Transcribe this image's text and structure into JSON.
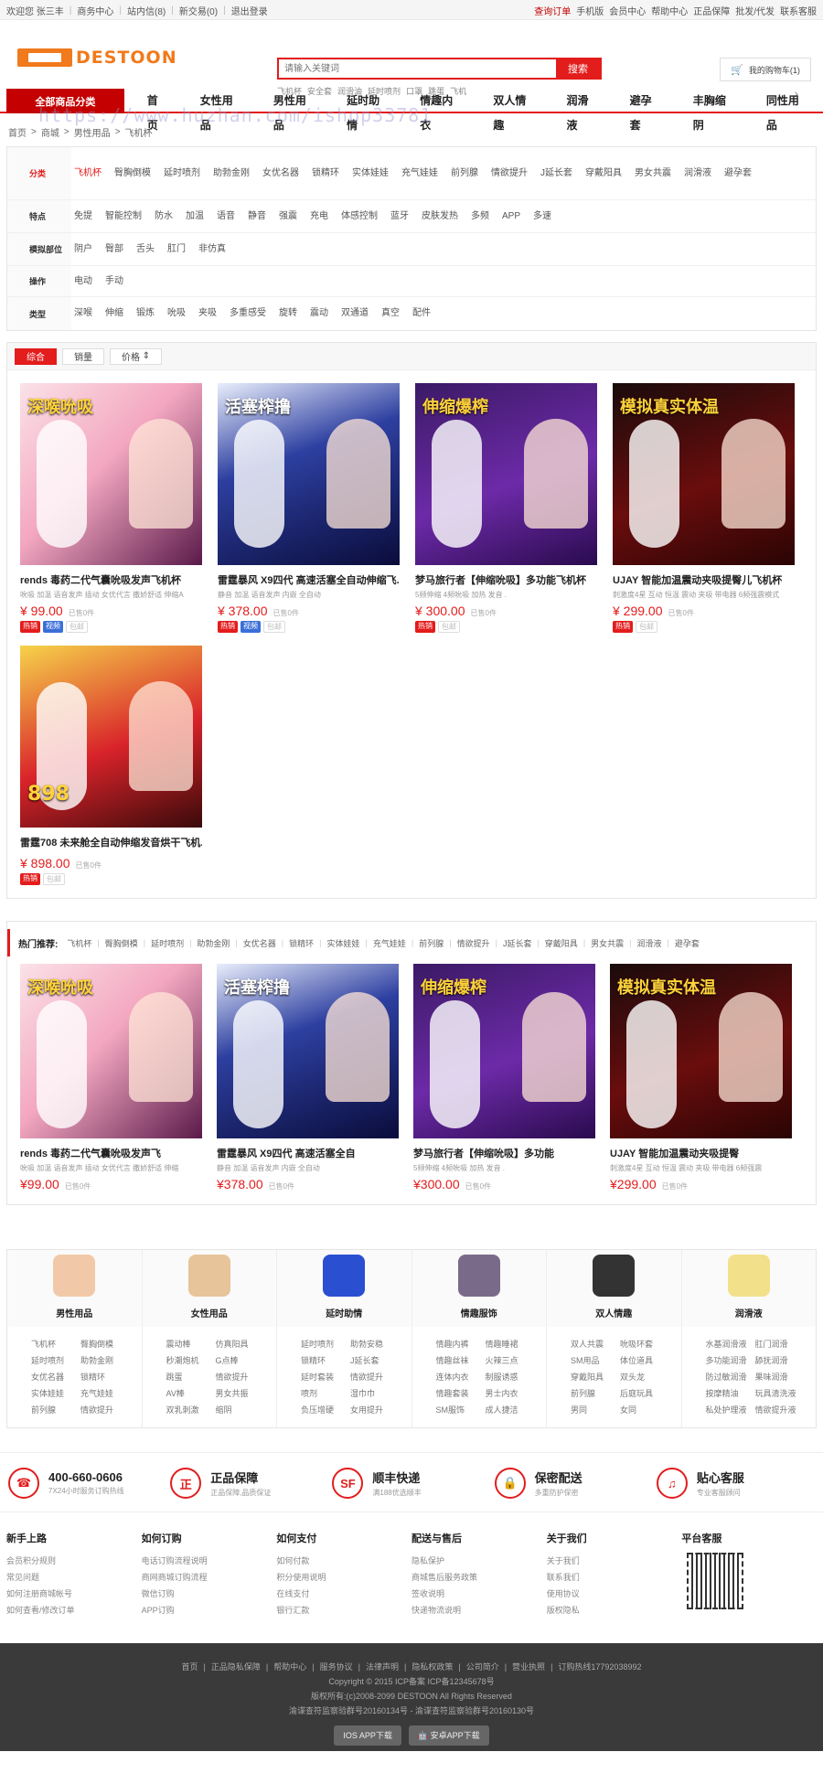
{
  "topbar": {
    "left": [
      "欢迎您 张三丰",
      "商务中心",
      "站内信(8)",
      "新交易(0)",
      "退出登录"
    ],
    "right": [
      "查询订单",
      "手机版",
      "会员中心",
      "帮助中心",
      "正品保障",
      "批发/代发",
      "联系客服"
    ]
  },
  "header": {
    "logo_text": "DESTOON",
    "search_placeholder": "请输入关键词",
    "search_button": "搜索",
    "hot_words": [
      "飞机杯",
      "安全套",
      "润滑油",
      "延时喷剂",
      "口罩",
      "跳蛋",
      "飞机"
    ],
    "cart_label": "我的购物车(1)"
  },
  "nav": {
    "all_categories": "全部商品分类",
    "items": [
      "首页",
      "女性用品",
      "男性用品",
      "延时助情",
      "情趣内衣",
      "双人情趣",
      "润滑液",
      "避孕套",
      "丰胸缩阴",
      "同性用品"
    ]
  },
  "watermark": "https://www.huzhan.com/ishop33781",
  "breadcrumb": [
    "首页",
    ">",
    "商城",
    ">",
    "男性用品",
    ">",
    "飞机杯"
  ],
  "filters": [
    {
      "label": "分类",
      "options": [
        "飞机杯",
        "臀胸倒模",
        "延时喷剂",
        "助勃金刚",
        "女优名器",
        "锁精环",
        "实体娃娃",
        "充气娃娃",
        "前列腺",
        "情欲提升",
        "J延长套",
        "穿戴阳具",
        "男女共震",
        "润滑液",
        "避孕套"
      ]
    },
    {
      "label": "特点",
      "options": [
        "免提",
        "智能控制",
        "防水",
        "加温",
        "语音",
        "静音",
        "强震",
        "充电",
        "体感控制",
        "蓝牙",
        "皮肤发热",
        "多频",
        "APP",
        "多速"
      ]
    },
    {
      "label": "模拟部位",
      "options": [
        "阴户",
        "臀部",
        "舌头",
        "肛门",
        "非仿真"
      ]
    },
    {
      "label": "操作",
      "options": [
        "电动",
        "手动"
      ]
    },
    {
      "label": "类型",
      "options": [
        "深喉",
        "伸缩",
        "锻炼",
        "吮吸",
        "夹吸",
        "多重感受",
        "旋转",
        "震动",
        "双通道",
        "真空",
        "配件"
      ]
    }
  ],
  "sort": {
    "comprehensive": "综合",
    "sales": "销量",
    "price": "价格"
  },
  "products": [
    {
      "name": "rends 毒药二代气囊吮吸发声飞机杯",
      "tags": "吮吸 加温 语音发声 插动 女优代言 撒娇舒适 伸缩A",
      "price": "¥ 99.00",
      "sold": "已售0件",
      "badges": [
        "热销",
        "视频",
        "包邮"
      ],
      "img": "im1",
      "title_overlay": "深喉吮吸"
    },
    {
      "name": "雷霆暴风 X9四代 高速活塞全自动伸缩飞...",
      "tags": "静音 加温 语音发声 内嵌 全自动",
      "price": "¥ 378.00",
      "sold": "已售0件",
      "badges": [
        "热销",
        "视频",
        "包邮"
      ],
      "img": "im2",
      "title_overlay": "活塞榨撸"
    },
    {
      "name": "梦马旅行者【伸缩吮吸】多功能飞机杯",
      "tags": "5频伸缩 4频吮吸 加热 发音 .",
      "price": "¥ 300.00",
      "sold": "已售0件",
      "badges": [
        "热销",
        "包邮"
      ],
      "img": "im3",
      "title_overlay": "伸缩爆榨"
    },
    {
      "name": "UJAY 智能加温震动夹吸提臀儿飞机杯",
      "tags": "刺激度4星 互动 恒温 震动 夹吸 带电器 6频强震模式",
      "price": "¥ 299.00",
      "sold": "已售0件",
      "badges": [
        "热销",
        "包邮"
      ],
      "img": "im4",
      "title_overlay": "模拟真实体温"
    },
    {
      "name": "雷霆708 未来舱全自动伸缩发音烘干飞机...",
      "tags": "",
      "price": "¥ 898.00",
      "sold": "已售0件",
      "badges": [
        "热销",
        "包邮"
      ],
      "img": "im5",
      "title_overlay": "898"
    }
  ],
  "hot": {
    "label": "热门推荐:",
    "items": [
      "飞机杯",
      "臀胸倒模",
      "延时喷剂",
      "助勃金刚",
      "女优名器",
      "锁精环",
      "实体娃娃",
      "充气娃娃",
      "前列腺",
      "情欲提升",
      "J延长套",
      "穿戴阳具",
      "男女共震",
      "润滑液",
      "避孕套"
    ],
    "products": [
      {
        "name": "rends 毒药二代气囊吮吸发声飞",
        "tags": "吮吸 加温 语音发声 插动 女优代言 撒娇舒适 伸缩",
        "price": "¥99.00",
        "sold": "已售0件",
        "img": "im1",
        "title_overlay": "深喉吮吸"
      },
      {
        "name": "雷霆暴风 X9四代 高速活塞全自",
        "tags": "静音 加温 语音发声 内嵌 全自动",
        "price": "¥378.00",
        "sold": "已售0件",
        "img": "im2",
        "title_overlay": "活塞榨撸"
      },
      {
        "name": "梦马旅行者【伸缩吮吸】多功能",
        "tags": "5频伸缩 4频吮吸 加热 发音 .",
        "price": "¥300.00",
        "sold": "已售0件",
        "img": "im3",
        "title_overlay": "伸缩爆榨"
      },
      {
        "name": "UJAY 智能加温震动夹吸提臀",
        "tags": "刺激度4星 互动 恒温 震动 夹吸 带电器 6频强震",
        "price": "¥299.00",
        "sold": "已售0件",
        "img": "im4",
        "title_overlay": "模拟真实体温"
      }
    ]
  },
  "categories": [
    {
      "title": "男性用品",
      "color": "#f2c9a8",
      "links": [
        "飞机杯",
        "臀胸倒模",
        "延时喷剂",
        "助勃金刚",
        "女优名器",
        "锁精环",
        "实体娃娃",
        "充气娃娃",
        "前列腺",
        "情欲提升"
      ]
    },
    {
      "title": "女性用品",
      "color": "#e8c49a",
      "links": [
        "震动棒",
        "仿真阳具",
        "秒潮炮机",
        "G点棒",
        "跳蛋",
        "情欲提升",
        "AV棒",
        "男女共振",
        "双乳刺激",
        "缩阴"
      ]
    },
    {
      "title": "延时助情",
      "color": "#2a4fd0",
      "links": [
        "延时喷剂",
        "助勃安稳",
        "锁精环",
        "J延长套",
        "延时套装",
        "情欲提升",
        "喷剂",
        "湿巾巾",
        "负压增硬",
        "女用提升"
      ]
    },
    {
      "title": "情趣服饰",
      "color": "#7a6a8a",
      "links": [
        "情趣内裤",
        "情趣睡裙",
        "情趣丝袜",
        "火辣三点",
        "连体内衣",
        "制服诱惑",
        "情趣套装",
        "男士内衣",
        "SM服饰",
        "成人捷洁"
      ]
    },
    {
      "title": "双人情趣",
      "color": "#333333",
      "links": [
        "双人共震",
        "吮吸环套",
        "SM用品",
        "体位道具",
        "穿戴阳具",
        "双头龙",
        "前列腺",
        "后庭玩具",
        "男同",
        "女同"
      ]
    },
    {
      "title": "润滑液",
      "color": "#f3e08a",
      "links": [
        "水基润滑液",
        "肛门润滑",
        "多功能润滑",
        "舔抚润滑",
        "防过敏润滑",
        "果味润滑",
        "按摩精油",
        "玩具清洗液",
        "私处护理液",
        "情欲提升液"
      ]
    }
  ],
  "services": [
    {
      "icon": "phone-icon",
      "glyph": "☎",
      "title": "400-660-0606",
      "sub": "7X24小时服务订购热线"
    },
    {
      "icon": "genuine-icon",
      "glyph": "正",
      "title": "正品保障",
      "sub": "正品保障,品质保证"
    },
    {
      "icon": "sf-express-icon",
      "glyph": "SF",
      "title": "顺丰快递",
      "sub": "满188优选顺丰"
    },
    {
      "icon": "lock-icon",
      "glyph": "🔒",
      "title": "保密配送",
      "sub": "多重防护保密"
    },
    {
      "icon": "headset-icon",
      "glyph": "♫",
      "title": "贴心客服",
      "sub": "专业客服顾问"
    }
  ],
  "footer_cols": [
    {
      "title": "新手上路",
      "links": [
        "会员积分规则",
        "常见问题",
        "如何注册商城帐号",
        "如何查看/修改订单"
      ]
    },
    {
      "title": "如何订购",
      "links": [
        "电话订购流程说明",
        "商网商城订购流程",
        "微信订购",
        "APP订购"
      ]
    },
    {
      "title": "如何支付",
      "links": [
        "如何付款",
        "积分使用说明",
        "在线支付",
        "银行汇款"
      ]
    },
    {
      "title": "配送与售后",
      "links": [
        "隐私保护",
        "商城售后服务政策",
        "签收说明",
        "快递物流说明"
      ]
    },
    {
      "title": "关于我们",
      "links": [
        "关于我们",
        "联系我们",
        "使用协议",
        "版权隐私"
      ]
    },
    {
      "title": "平台客服",
      "links": []
    }
  ],
  "bottom": {
    "links": [
      "首页",
      "正品隐私保障",
      "帮助中心",
      "服务协议",
      "法律声明",
      "隐私权政策",
      "公司简介",
      "营业执照",
      "订购热线17792038992"
    ],
    "line1": "Copyright © 2015 ICP备案 ICP备12345678号",
    "line2": "版权所有:(c)2008-2099 DESTOON All Rights Reserved",
    "line3": "渝谍查符监察验群号20160134号 - 渝谍查符监察验群号20160130号",
    "ios": "IOS APP下载",
    "android": "安卓APP下载"
  }
}
